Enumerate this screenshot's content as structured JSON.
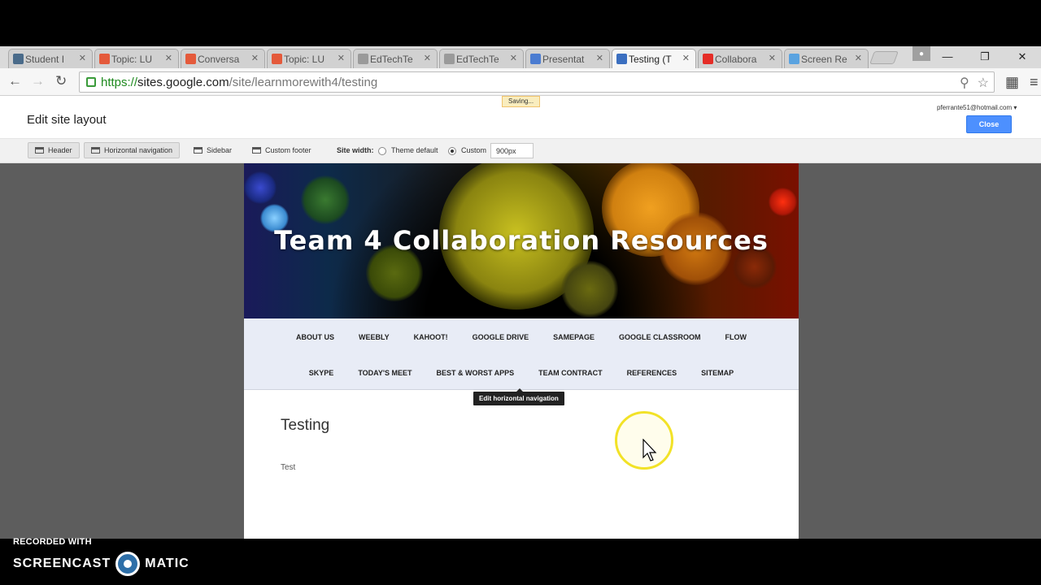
{
  "tabs": [
    {
      "label": "Student I",
      "icon": "classroom-icon",
      "color": "#4a6b8a"
    },
    {
      "label": "Topic: LU",
      "icon": "lifesaver-icon",
      "color": "#e45a3b"
    },
    {
      "label": "Conversa",
      "icon": "lifesaver-icon",
      "color": "#e45a3b"
    },
    {
      "label": "Topic: LU",
      "icon": "lifesaver-icon",
      "color": "#e45a3b"
    },
    {
      "label": "EdTechTe",
      "icon": "loading-icon",
      "color": "#9a9a9a"
    },
    {
      "label": "EdTechTe",
      "icon": "loading-icon",
      "color": "#9a9a9a"
    },
    {
      "label": "Presentat",
      "icon": "slides-icon",
      "color": "#4b7cd1"
    },
    {
      "label": "Testing (T",
      "icon": "sites-icon",
      "color": "#3b6fc0"
    },
    {
      "label": "Collabora",
      "icon": "youtube-icon",
      "color": "#e52d27"
    },
    {
      "label": "Screen Re",
      "icon": "screencast-icon",
      "color": "#5aa3e0"
    }
  ],
  "active_tab": "Testing (T",
  "url": {
    "secure": "https://",
    "host": "sites.google.com",
    "path": "/site/learnmorewith4/testing"
  },
  "edit_header": {
    "title": "Edit site layout",
    "saving": "Saving...",
    "account": "pferrante51@hotmail.com",
    "close": "Close"
  },
  "layout_bar": {
    "header": "Header",
    "horizontal_navigation": "Horizontal navigation",
    "sidebar": "Sidebar",
    "custom_footer": "Custom footer",
    "site_width_label": "Site width:",
    "theme_default": "Theme default",
    "custom": "Custom",
    "custom_selected": true,
    "width_value": "900px"
  },
  "site": {
    "title": "Team 4 Collaboration Resources",
    "nav_row1": [
      "ABOUT US",
      "WEEBLY",
      "KAHOOT!",
      "GOOGLE DRIVE",
      "SAMEPAGE",
      "GOOGLE CLASSROOM",
      "FLOW"
    ],
    "nav_row2": [
      "SKYPE",
      "TODAY'S MEET",
      "BEST & WORST APPS",
      "TEAM CONTRACT",
      "REFERENCES",
      "SITEMAP"
    ],
    "tooltip": "Edit horizontal navigation",
    "page_title": "Testing",
    "page_body": "Test"
  },
  "watermark": {
    "line1": "RECORDED WITH",
    "brand_left": "SCREENCAST",
    "brand_right": "MATIC"
  }
}
